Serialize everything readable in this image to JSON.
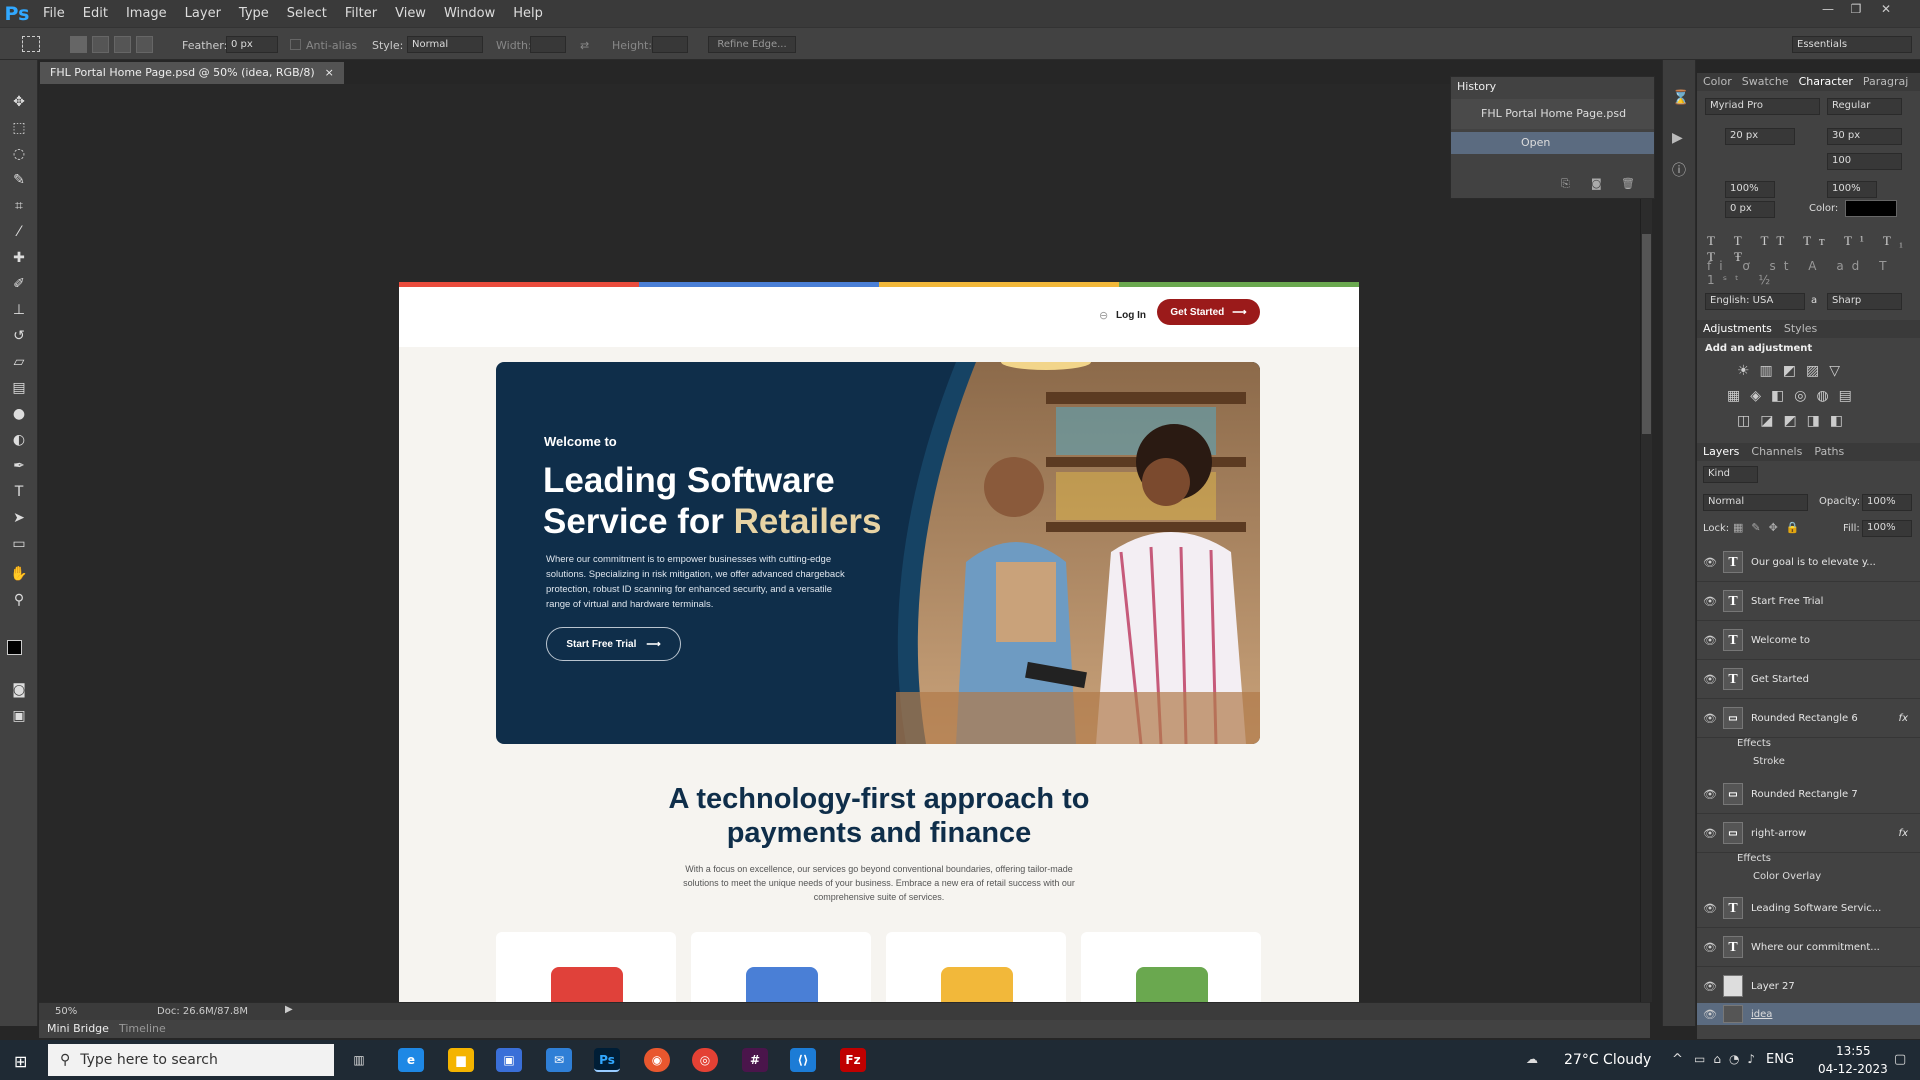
{
  "app": {
    "logo": "Ps"
  },
  "menu": [
    "File",
    "Edit",
    "Image",
    "Layer",
    "Type",
    "Select",
    "Filter",
    "View",
    "Window",
    "Help"
  ],
  "window_controls": {
    "minimize": "—",
    "restore": "❐",
    "close": "✕"
  },
  "options": {
    "feather_label": "Feather:",
    "feather_value": "0 px",
    "antialias_label": "Anti-alias",
    "style_label": "Style:",
    "style_value": "Normal",
    "width_label": "Width:",
    "height_label": "Height:",
    "refine_label": "Refine Edge...",
    "workspace": "Essentials"
  },
  "document_tab": {
    "title": "FHL Portal Home Page.psd @ 50% (idea, RGB/8)",
    "close": "×"
  },
  "page": {
    "stripe_colors": [
      "#e94b3c",
      "#4a7fd6",
      "#f2b83a",
      "#6aa84f"
    ],
    "login": "Log In",
    "get_started": "Get Started",
    "hero": {
      "welcome": "Welcome to",
      "title_1": "Leading Software",
      "title_2": "Service for ",
      "title_accent": "Retailers",
      "body": "Where our commitment is to empower businesses with cutting-edge solutions. Specializing in risk mitigation, we offer advanced chargeback protection, robust ID scanning for enhanced security, and a versatile range of virtual and hardware terminals.",
      "cta": "Start Free Trial"
    },
    "section_title": "A technology-first approach to payments and finance",
    "section_body": "With a focus on excellence, our services go beyond conventional boundaries, offering tailor-made solutions to meet the unique needs of your business. Embrace a new era of retail success with our comprehensive suite of services.",
    "card_colors": [
      "#e0413a",
      "#4a7fd6",
      "#f2b83a",
      "#6aa84f"
    ]
  },
  "status": {
    "zoom": "50%",
    "doc": "Doc: 26.6M/87.8M"
  },
  "bottom_tabs": [
    "Mini Bridge",
    "Timeline"
  ],
  "history": {
    "tab": "History",
    "items": [
      "FHL Portal Home Page.psd",
      "Open"
    ]
  },
  "character": {
    "tabs": [
      "Color",
      "Swatche",
      "Character",
      "Paragraj"
    ],
    "font": "Myriad Pro",
    "style": "Regular",
    "size": "20 px",
    "leading": "30 px",
    "tracking": "100",
    "vscale": "100%",
    "hscale": "100%",
    "baseline": "0 px",
    "color_label": "Color:",
    "language": "English: USA",
    "aa_label": "a",
    "antialias": "Sharp"
  },
  "adjustments": {
    "tabs": [
      "Adjustments",
      "Styles"
    ],
    "heading": "Add an adjustment"
  },
  "layers_panel": {
    "tabs": [
      "Layers",
      "Channels",
      "Paths"
    ],
    "kind": "Kind",
    "blend": "Normal",
    "opacity_label": "Opacity:",
    "opacity": "100%",
    "lock_label": "Lock:",
    "fill_label": "Fill:",
    "fill": "100%",
    "layers": [
      {
        "name": "Our goal is to elevate y...",
        "type": "T"
      },
      {
        "name": "Start Free Trial",
        "type": "T"
      },
      {
        "name": "Welcome to",
        "type": "T"
      },
      {
        "name": "Get Started",
        "type": "T"
      },
      {
        "name": "Rounded Rectangle 6",
        "type": "shape"
      },
      {
        "name": "Effects",
        "type": "fx"
      },
      {
        "name": "Stroke",
        "type": "fx"
      },
      {
        "name": "Rounded Rectangle 7",
        "type": "shape"
      },
      {
        "name": "right-arrow",
        "type": "shape"
      },
      {
        "name": "Effects",
        "type": "fx"
      },
      {
        "name": "Color Overlay",
        "type": "fx"
      },
      {
        "name": "Leading Software Servic...",
        "type": "T"
      },
      {
        "name": "Where our commitment...",
        "type": "T"
      },
      {
        "name": "Layer 27",
        "type": "img"
      },
      {
        "name": "idea",
        "type": "img"
      }
    ]
  },
  "taskbar": {
    "search_placeholder": "Type here to search",
    "weather": "27°C  Cloudy",
    "lang": "ENG",
    "time": "13:55",
    "date": "04-12-2023"
  }
}
